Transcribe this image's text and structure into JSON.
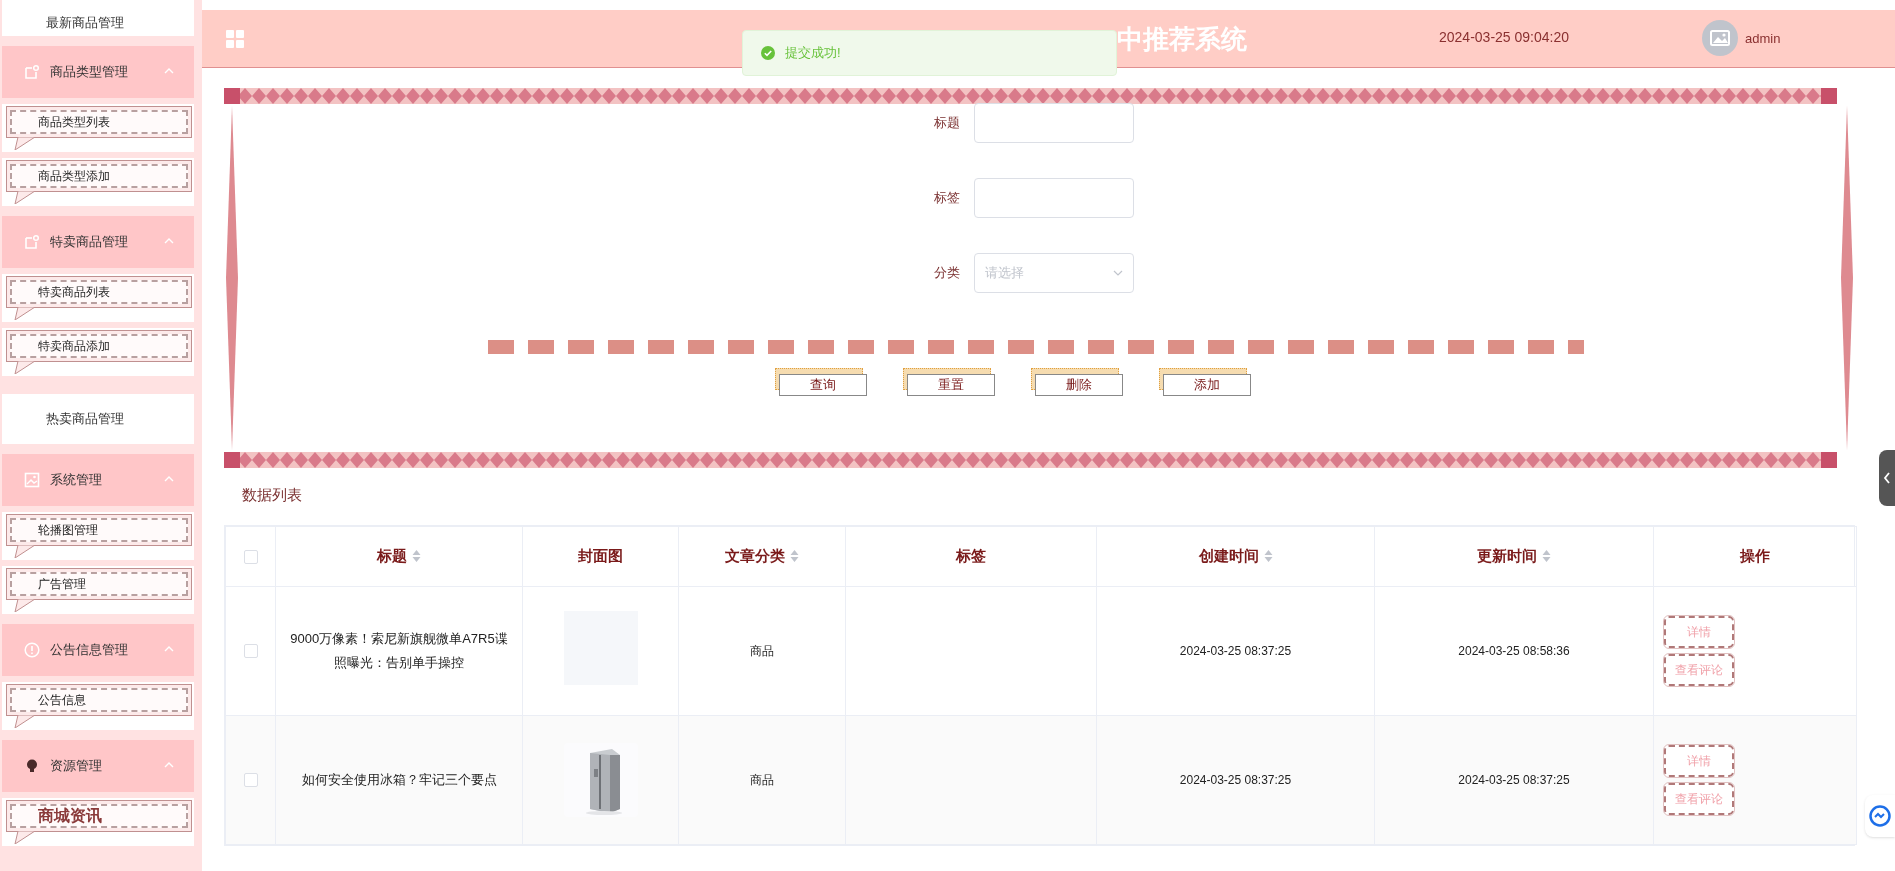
{
  "header": {
    "title_visible": "中推荐系统",
    "datetime": "2024-03-25 09:04:20",
    "user": "admin"
  },
  "toast": {
    "message": "提交成功!"
  },
  "sidebar": {
    "items": [
      {
        "kind": "plain",
        "label": "最新商品管理"
      },
      {
        "kind": "group",
        "label": "商品类型管理",
        "expanded": true,
        "children": [
          {
            "label": "商品类型列表",
            "selected": false
          },
          {
            "label": "商品类型添加",
            "selected": false
          }
        ]
      },
      {
        "kind": "group",
        "label": "特卖商品管理",
        "expanded": true,
        "children": [
          {
            "label": "特卖商品列表",
            "selected": false
          },
          {
            "label": "特卖商品添加",
            "selected": false
          }
        ]
      },
      {
        "kind": "plain",
        "label": "热卖商品管理"
      },
      {
        "kind": "group",
        "label": "系统管理",
        "expanded": true,
        "children": [
          {
            "label": "轮播图管理",
            "selected": false
          },
          {
            "label": "广告管理",
            "selected": false
          }
        ]
      },
      {
        "kind": "group",
        "label": "公告信息管理",
        "expanded": true,
        "children": [
          {
            "label": "公告信息",
            "selected": false
          }
        ]
      },
      {
        "kind": "group",
        "label": "资源管理",
        "expanded": true,
        "children": [
          {
            "label": "商城资讯",
            "selected": true
          }
        ]
      }
    ]
  },
  "search_form": {
    "fields": [
      {
        "kind": "text",
        "label": "标题"
      },
      {
        "kind": "text",
        "label": "标签"
      },
      {
        "kind": "select",
        "label": "分类",
        "placeholder": "请选择"
      }
    ],
    "buttons": [
      "查询",
      "重置",
      "删除",
      "添加"
    ]
  },
  "section_title": "数据列表",
  "table": {
    "columns": [
      {
        "kind": "checkbox",
        "checked": false
      },
      {
        "kind": "text",
        "label": "标题",
        "sortable": true
      },
      {
        "kind": "text",
        "label": "封面图",
        "sortable": false
      },
      {
        "kind": "text",
        "label": "文章分类",
        "sortable": true
      },
      {
        "kind": "text",
        "label": "标签",
        "sortable": false
      },
      {
        "kind": "text",
        "label": "创建时间",
        "sortable": true
      },
      {
        "kind": "text",
        "label": "更新时间",
        "sortable": true
      },
      {
        "kind": "text",
        "label": "操作",
        "sortable": false
      }
    ],
    "rows": [
      {
        "checked": false,
        "title": "9000万像素！索尼新旗舰微单A7R5谍照曝光：告别单手操控",
        "cover": {
          "kind": "blank"
        },
        "category": "商品",
        "created": "2024-03-25 08:37:25",
        "updated": "2024-03-25 08:58:36",
        "actions": [
          "详情",
          "查看评论"
        ]
      },
      {
        "checked": false,
        "title": "如何安全使用冰箱？牢记三个要点",
        "cover": {
          "kind": "picture"
        },
        "category": "商品",
        "created": "2024-03-25 08:37:25",
        "updated": "2024-03-25 08:37:25",
        "actions": [
          "详情",
          "查看评论"
        ]
      }
    ]
  }
}
